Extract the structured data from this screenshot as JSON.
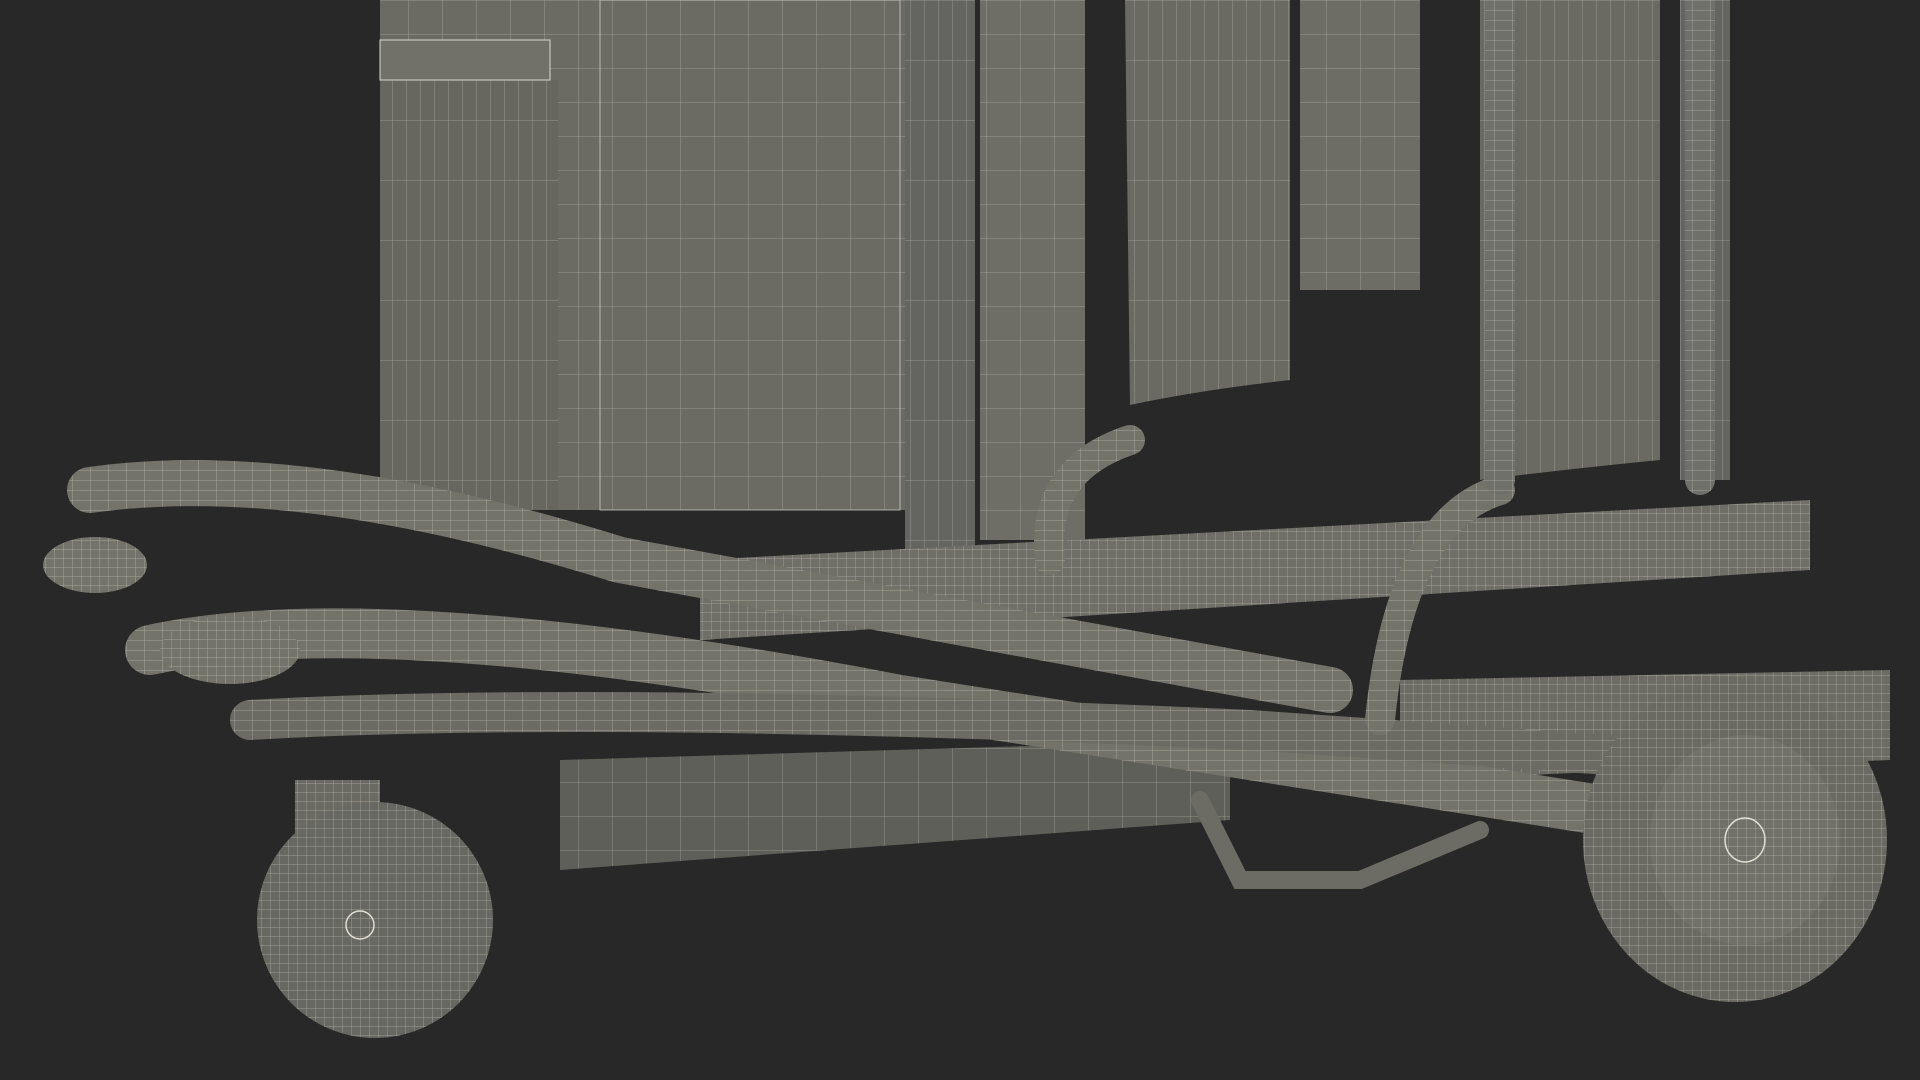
{
  "scene": {
    "subject": "",
    "colors": {
      "background": "#282828",
      "surface": "#6c6c66",
      "surface_dark": "#5a5a55",
      "surface_light": "#7a7a73",
      "wire": "#d8d8cc",
      "tube": "#737369"
    }
  }
}
